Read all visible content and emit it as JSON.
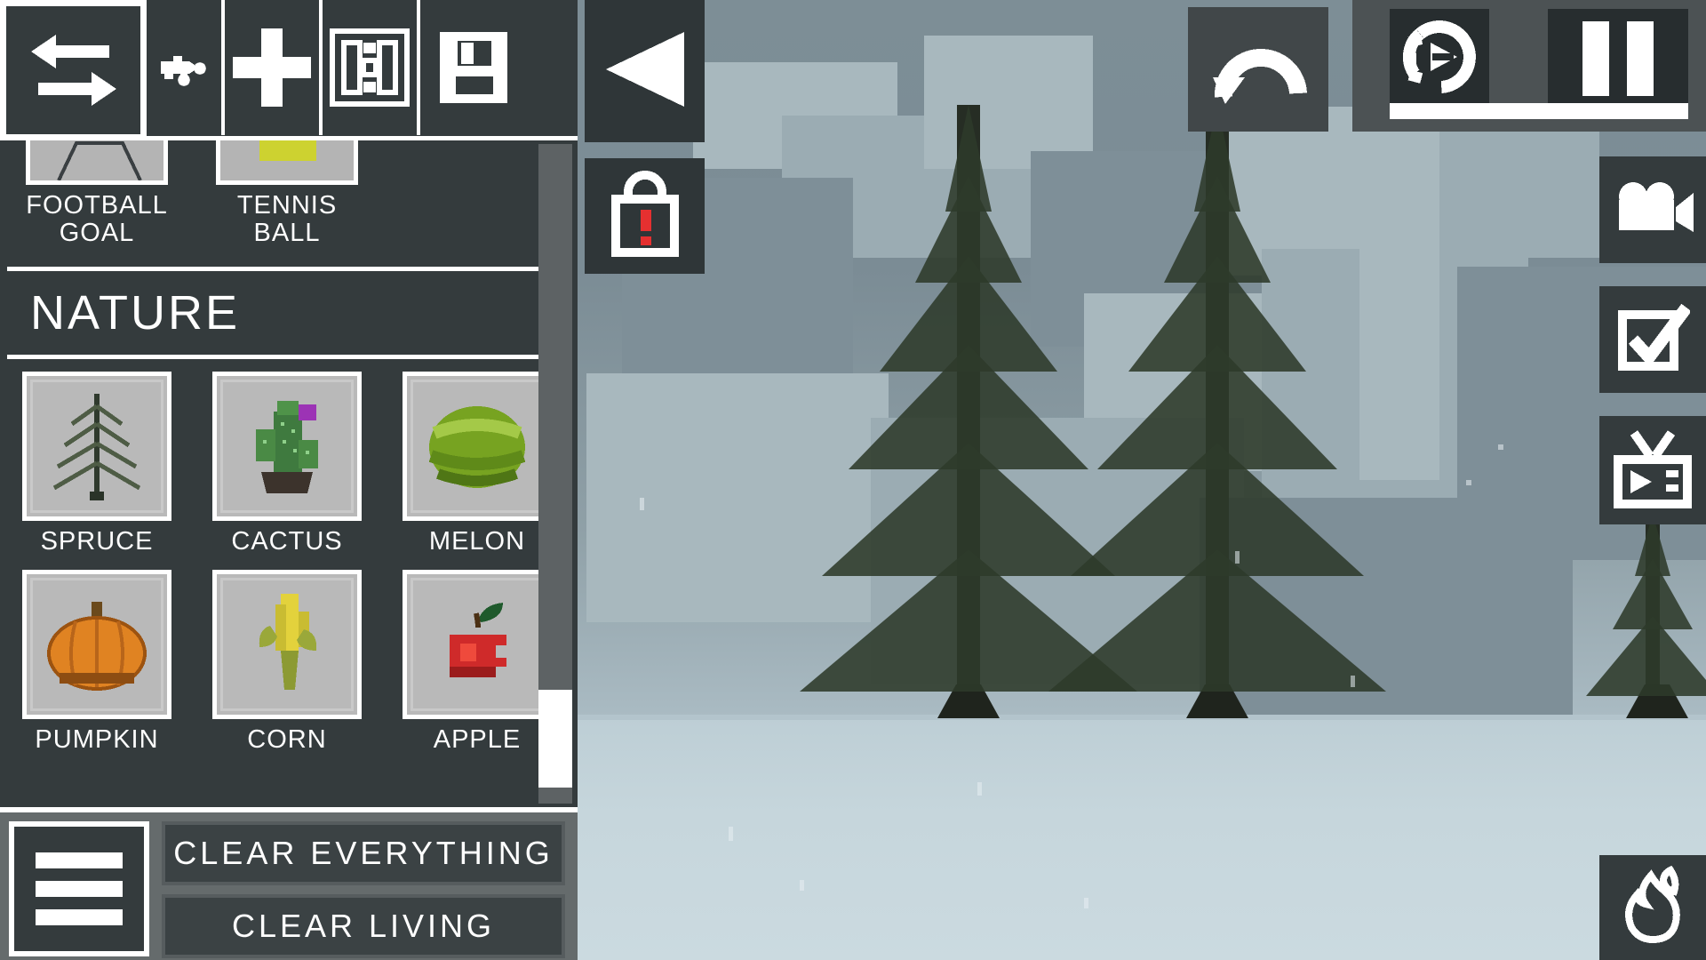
{
  "app": {
    "scene_name": "snowy-pixel-forest",
    "background_colors": {
      "sky_top": "#7d8e96",
      "sky_bottom": "#cfdde2",
      "ground": "#c6d6dc",
      "tree_dark": "#262d24",
      "panel": "#343b3d",
      "panel_light": "#656b6c",
      "outline": "#ffffff",
      "alert_red": "#e53030"
    }
  },
  "toolbar": {
    "items": [
      {
        "id": "swap",
        "icon": "swap-arrows-icon",
        "label": "Swap",
        "selected": true
      },
      {
        "id": "pick",
        "icon": "eyedropper-icon",
        "label": "Pick",
        "selected": false
      },
      {
        "id": "add",
        "icon": "plus-icon",
        "label": "Add",
        "selected": false
      },
      {
        "id": "layout",
        "icon": "layout-panels-icon",
        "label": "Layout",
        "selected": false
      },
      {
        "id": "save",
        "icon": "floppy-disk-icon",
        "label": "Save",
        "selected": false
      }
    ]
  },
  "side_controls": {
    "collapse": {
      "icon": "triangle-left-icon",
      "label": "Collapse panel"
    },
    "lock": {
      "icon": "lock-alert-icon",
      "label": "Locked"
    }
  },
  "browser": {
    "previous_row": [
      {
        "name": "FOOTBALL GOAL",
        "icon": "football-goal-icon"
      },
      {
        "name": "TENNIS BALL",
        "icon": "tennis-ball-icon"
      }
    ],
    "section_title": "NATURE",
    "items": [
      {
        "name": "SPRUCE",
        "icon": "spruce-tree-icon"
      },
      {
        "name": "CACTUS",
        "icon": "cactus-icon"
      },
      {
        "name": "MELON",
        "icon": "melon-icon"
      },
      {
        "name": "PUMPKIN",
        "icon": "pumpkin-icon"
      },
      {
        "name": "CORN",
        "icon": "corn-icon"
      },
      {
        "name": "APPLE",
        "icon": "apple-icon"
      }
    ],
    "scrollbar": {
      "position_percent": 82
    }
  },
  "bottom_bar": {
    "menu": {
      "icon": "hamburger-menu-icon",
      "label": "Menu"
    },
    "actions": [
      {
        "label": "CLEAR EVERYTHING"
      },
      {
        "label": "CLEAR LIVING"
      }
    ]
  },
  "top_right": {
    "undo": {
      "icon": "undo-arrow-icon",
      "label": "Undo"
    },
    "speed": {
      "icon": "speed-dial-play-icon",
      "label": "Speed"
    },
    "pause": {
      "icon": "pause-icon",
      "label": "Pause"
    },
    "progress_percent": 100
  },
  "right_rail": [
    {
      "id": "camera",
      "icon": "video-camera-icon",
      "label": "Camera"
    },
    {
      "id": "select",
      "icon": "checkbox-check-icon",
      "label": "Select"
    },
    {
      "id": "monitor",
      "icon": "tv-broadcast-icon",
      "label": "Display"
    }
  ],
  "fire_tool": {
    "icon": "flame-icon",
    "label": "Fire"
  }
}
